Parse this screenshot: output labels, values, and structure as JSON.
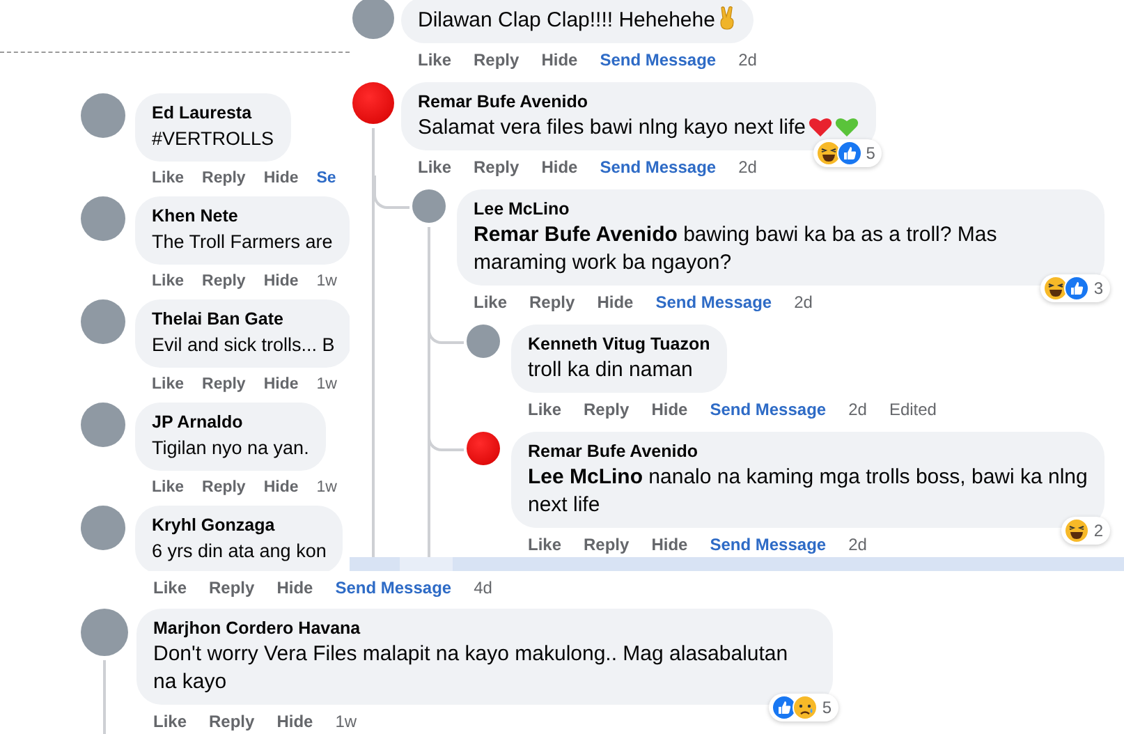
{
  "left_panel": {
    "comments": [
      {
        "author": "Ed Lauresta",
        "avatar": {
          "kind": "photo"
        },
        "text": "#VERTROLLS",
        "actions": [
          {
            "label": "Like",
            "kind": "button"
          },
          {
            "label": "Reply",
            "kind": "button"
          },
          {
            "label": "Hide",
            "kind": "button"
          },
          {
            "label": "Se",
            "kind": "link"
          }
        ]
      },
      {
        "author": "Khen Nete",
        "avatar": {
          "kind": "photo"
        },
        "text": "The Troll Farmers are",
        "actions": [
          {
            "label": "Like",
            "kind": "button"
          },
          {
            "label": "Reply",
            "kind": "button"
          },
          {
            "label": "Hide",
            "kind": "button"
          },
          {
            "label": "1w",
            "kind": "time"
          }
        ]
      },
      {
        "author": "Thelai Ban Gate",
        "avatar": {
          "kind": "photo"
        },
        "text": "Evil and sick trolls... B",
        "actions": [
          {
            "label": "Like",
            "kind": "button"
          },
          {
            "label": "Reply",
            "kind": "button"
          },
          {
            "label": "Hide",
            "kind": "button"
          },
          {
            "label": "1w",
            "kind": "time"
          }
        ]
      },
      {
        "author": "JP Arnaldo",
        "avatar": {
          "kind": "photo"
        },
        "text": "Tigilan nyo na yan.",
        "actions": [
          {
            "label": "Like",
            "kind": "button"
          },
          {
            "label": "Reply",
            "kind": "button"
          },
          {
            "label": "Hide",
            "kind": "button"
          },
          {
            "label": "1w",
            "kind": "time"
          }
        ]
      },
      {
        "author": "Kryhl Gonzaga",
        "avatar": {
          "kind": "photo"
        },
        "text": "6 yrs din ata ang kon"
      }
    ]
  },
  "right_panel": {
    "comments": [
      {
        "avatar": {
          "kind": "photo"
        },
        "text": "Dilawan Clap Clap!!!! Hehehehe",
        "emojis": [
          {
            "kind": "victory-hand"
          }
        ],
        "actions": [
          {
            "label": "Like",
            "kind": "button"
          },
          {
            "label": "Reply",
            "kind": "button"
          },
          {
            "label": "Hide",
            "kind": "button"
          },
          {
            "label": "Send Message",
            "kind": "link"
          },
          {
            "label": "2d",
            "kind": "time"
          }
        ]
      },
      {
        "author": "Remar Bufe Avenido",
        "avatar": {
          "kind": "red-disc"
        },
        "text": "Salamat vera files bawi nlng kayo next life",
        "emojis": [
          {
            "kind": "red-heart"
          },
          {
            "kind": "green-heart"
          }
        ],
        "reactions": {
          "icons": [
            {
              "kind": "haha"
            },
            {
              "kind": "like"
            }
          ],
          "count": "5"
        },
        "actions": [
          {
            "label": "Like",
            "kind": "button"
          },
          {
            "label": "Reply",
            "kind": "button"
          },
          {
            "label": "Hide",
            "kind": "button"
          },
          {
            "label": "Send Message",
            "kind": "link"
          },
          {
            "label": "2d",
            "kind": "time"
          }
        ],
        "replies": [
          {
            "author": "Lee McLino",
            "avatar": {
              "kind": "photo"
            },
            "text": "**Remar Bufe Avenido** bawing bawi ka ba as a troll? Mas maraming work ba ngayon?",
            "reactions": {
              "icons": [
                {
                  "kind": "haha"
                },
                {
                  "kind": "like"
                }
              ],
              "count": "3"
            },
            "actions": [
              {
                "label": "Like",
                "kind": "button"
              },
              {
                "label": "Reply",
                "kind": "button"
              },
              {
                "label": "Hide",
                "kind": "button"
              },
              {
                "label": "Send Message",
                "kind": "link"
              },
              {
                "label": "2d",
                "kind": "time"
              }
            ],
            "replies": [
              {
                "author": "Kenneth Vitug Tuazon",
                "avatar": {
                  "kind": "photo"
                },
                "text": "troll ka din naman",
                "actions": [
                  {
                    "label": "Like",
                    "kind": "button"
                  },
                  {
                    "label": "Reply",
                    "kind": "button"
                  },
                  {
                    "label": "Hide",
                    "kind": "button"
                  },
                  {
                    "label": "Send Message",
                    "kind": "link"
                  },
                  {
                    "label": "2d",
                    "kind": "time"
                  },
                  {
                    "label": "Edited",
                    "kind": "note"
                  }
                ]
              },
              {
                "author": "Remar Bufe Avenido",
                "avatar": {
                  "kind": "red-disc"
                },
                "text": "**Lee McLino** nanalo na kaming mga trolls boss, bawi ka nlng next life",
                "reactions": {
                  "icons": [
                    {
                      "kind": "haha"
                    }
                  ],
                  "count": "2"
                },
                "actions": [
                  {
                    "label": "Like",
                    "kind": "button"
                  },
                  {
                    "label": "Reply",
                    "kind": "button"
                  },
                  {
                    "label": "Hide",
                    "kind": "button"
                  },
                  {
                    "label": "Send Message",
                    "kind": "link"
                  },
                  {
                    "label": "2d",
                    "kind": "time"
                  }
                ]
              }
            ]
          }
        ]
      }
    ]
  },
  "bottom_panel": {
    "actions": [
      {
        "label": "Like",
        "kind": "button"
      },
      {
        "label": "Reply",
        "kind": "button"
      },
      {
        "label": "Hide",
        "kind": "button"
      },
      {
        "label": "Send Message",
        "kind": "link"
      },
      {
        "label": "4d",
        "kind": "time"
      }
    ],
    "comments": [
      {
        "author": "Marjhon Cordero Havana",
        "avatar": {
          "kind": "photo"
        },
        "thread_line": true,
        "text": "Don't worry Vera Files malapit na kayo makulong.. Mag alasabalutan na kayo",
        "reactions": {
          "icons": [
            {
              "kind": "like"
            },
            {
              "kind": "sad"
            }
          ],
          "count": "5"
        },
        "actions": [
          {
            "label": "Like",
            "kind": "button"
          },
          {
            "label": "Reply",
            "kind": "button"
          },
          {
            "label": "Hide",
            "kind": "button"
          },
          {
            "label": "1w",
            "kind": "time"
          }
        ]
      }
    ]
  }
}
